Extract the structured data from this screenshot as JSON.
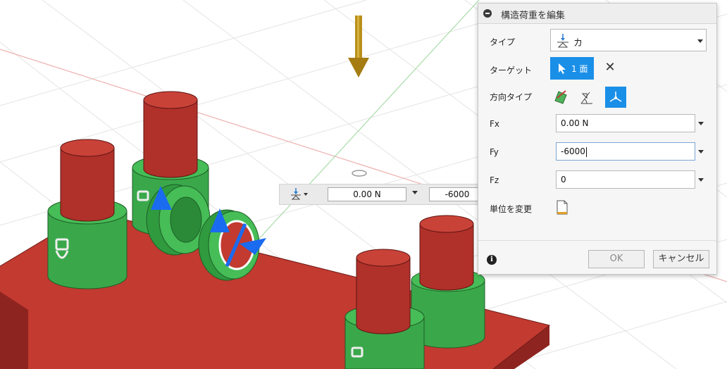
{
  "dialog": {
    "title": "構造荷重を編集",
    "type_label": "タイプ",
    "type_value": "カ",
    "target_label": "ターゲット",
    "target_value": "1 面",
    "direction_type_label": "方向タイプ",
    "fx_label": "Fx",
    "fx_value": "0.00 N",
    "fy_label": "Fy",
    "fy_value": "-6000",
    "fz_label": "Fz",
    "fz_value": "0",
    "change_units_label": "単位を変更",
    "ok_label": "OK",
    "cancel_label": "キャンセル"
  },
  "canvas_toolbar": {
    "value_1": "0.00 N",
    "value_2": "-6000"
  },
  "colors": {
    "accent": "#1a8fe8",
    "plate_red": "#c0312b",
    "cylinder_red": "#b0302a",
    "ring_green": "#3aa84a",
    "load_arrow": "#b8901a",
    "grid_axis_red": "#e89090",
    "grid_axis_green": "#9ad49a"
  }
}
